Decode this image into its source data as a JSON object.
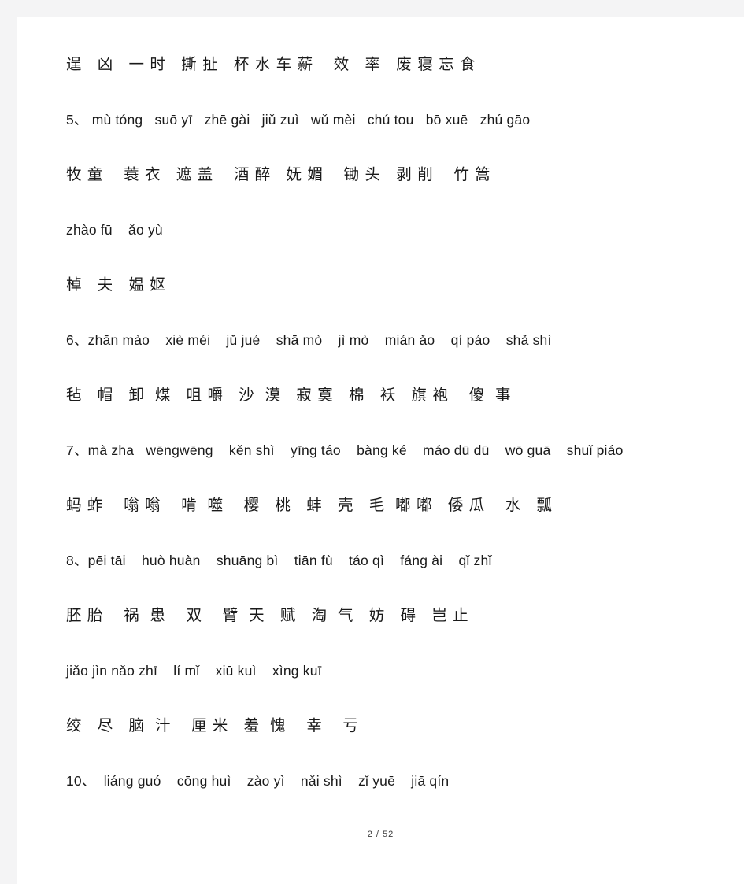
{
  "document": {
    "lines": [
      {
        "id": "line-1-hanzi",
        "kind": "hanzi",
        "text": "逞   凶   一 时   撕 扯   杯 水 车 薪    效   率   废 寝 忘 食"
      },
      {
        "id": "line-5-pinyin",
        "kind": "pinyin",
        "text": "5、 mù tóng   suō yī   zhē gài   jiǔ zuì   wǔ mèi   chú tou   bō xuē   zhú gāo"
      },
      {
        "id": "line-5-hanzi",
        "kind": "hanzi",
        "text": "牧 童    蓑 衣   遮 盖    酒 醉   妩 媚    锄 头   剥 削    竹 篙"
      },
      {
        "id": "line-5b-pinyin",
        "kind": "pinyin",
        "text": "zhào fū    ǎo yù"
      },
      {
        "id": "line-5b-hanzi",
        "kind": "hanzi",
        "text": "棹   夫   媪 妪"
      },
      {
        "id": "line-6-pinyin",
        "kind": "pinyin",
        "text": "6、zhān mào    xiè méi    jǔ jué    shā mò    jì mò    mián ǎo    qí páo    shǎ shì"
      },
      {
        "id": "line-6-hanzi",
        "kind": "hanzi",
        "text": "毡   帽   卸  煤   咀 嚼   沙  漠   寂 寞   棉   袄   旗 袍    傻  事"
      },
      {
        "id": "line-7-pinyin",
        "kind": "pinyin",
        "text": "7、mà zha   wēngwēng    kěn shì    yīng táo    bàng ké    máo dū dū    wō guā    shuǐ piáo"
      },
      {
        "id": "line-7-hanzi",
        "kind": "hanzi",
        "text": "蚂 蚱    嗡 嗡    啃  噬    樱   桃   蚌   壳   毛  嘟 嘟   倭 瓜    水   瓢"
      },
      {
        "id": "line-8-pinyin",
        "kind": "pinyin",
        "text": "8、pēi tāi    huò huàn    shuāng bì    tiān fù    táo qì    fáng ài    qǐ zhǐ"
      },
      {
        "id": "line-8-hanzi",
        "kind": "hanzi",
        "text": "胚 胎    祸  患    双    臂  天   赋   淘  气   妨   碍   岂 止"
      },
      {
        "id": "line-9-pinyin",
        "kind": "pinyin",
        "text": "jiǎo jìn nǎo zhī    lí mǐ    xiū kuì    xìng kuī"
      },
      {
        "id": "line-9-hanzi",
        "kind": "hanzi",
        "text": "绞   尽   脑  汁    厘 米   羞  愧    幸    亏"
      },
      {
        "id": "line-10-pinyin",
        "kind": "pinyin",
        "text": "10、  liáng guó    cōng huì    zào yì    nǎi shì    zǐ yuē    jiā qín"
      }
    ]
  },
  "footer": {
    "page_indicator": "2 / 52"
  }
}
